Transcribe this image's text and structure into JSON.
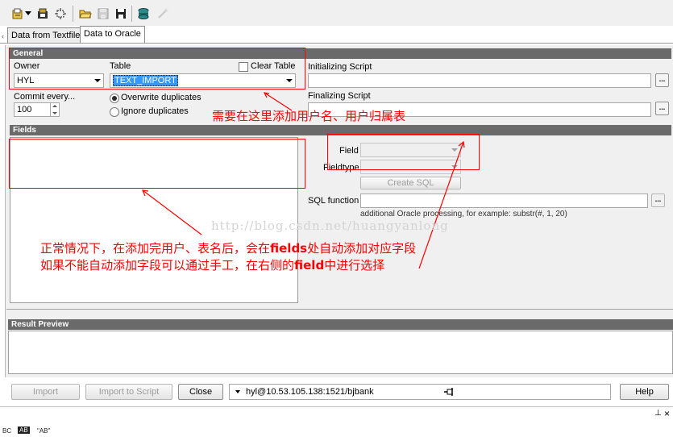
{
  "toolbar": {
    "icons": [
      "open-wizard-icon",
      "dropdown-arrow-icon",
      "load-icon",
      "settings-icon",
      "open-folder-icon",
      "save-icon",
      "save-as-icon",
      "database-icon",
      "magic-wand-icon"
    ]
  },
  "tabs": [
    {
      "label": "Data from Textfile",
      "active": false
    },
    {
      "label": "Data to Oracle",
      "active": true
    }
  ],
  "general": {
    "header": "General",
    "owner_label": "Owner",
    "owner_value": "HYL",
    "table_label": "Table",
    "table_value": "TEXT_IMPORT",
    "clear_table_label": "Clear Table",
    "clear_table_checked": false,
    "commit_label": "Commit every...",
    "commit_value": "100",
    "duplicates": [
      {
        "label": "Overwrite duplicates",
        "checked": true
      },
      {
        "label": "Ignore duplicates",
        "checked": false
      }
    ],
    "initializing_script_label": "Initializing Script",
    "initializing_script_value": "",
    "finalizing_script_label": "Finalizing Script",
    "finalizing_script_value": "",
    "ellipsis_label": "..."
  },
  "fields": {
    "header": "Fields",
    "field_label": "Field",
    "field_value": "",
    "fieldtype_label": "Fieldtype",
    "fieldtype_value": "",
    "create_sql_label": "Create SQL",
    "sql_function_label": "SQL function",
    "sql_function_value": "",
    "sql_hint": "additional Oracle processing, for example: substr(#, 1, 20)",
    "ellipsis_label": "..."
  },
  "result_preview": {
    "header": "Result Preview"
  },
  "bottom": {
    "import_label": "Import",
    "import_to_script_label": "Import to Script",
    "close_label": "Close",
    "connection": "hyl@10.53.105.138:1521/bjbank",
    "help_label": "Help"
  },
  "annotations": {
    "top": "需要在这里添加用户名、用户归属表",
    "line1_part1": "正常情况下，在添加完用户、表名后，会在",
    "line1_bold": "fields",
    "line1_part2": "处自动添加对应字段",
    "line2_part1": "如果不能自动添加字段可以通过手工，在右侧的",
    "line2_bold": "field",
    "line2_part2": "中进行选择",
    "watermark": "http://blog.csdn.net/huangyanlong",
    "color": "#ff0000"
  },
  "dock": {
    "pin_glyph": "⊥",
    "close_glyph": "×"
  },
  "statusbar": {
    "items": [
      "BC",
      "AB",
      "\"AB\""
    ]
  }
}
